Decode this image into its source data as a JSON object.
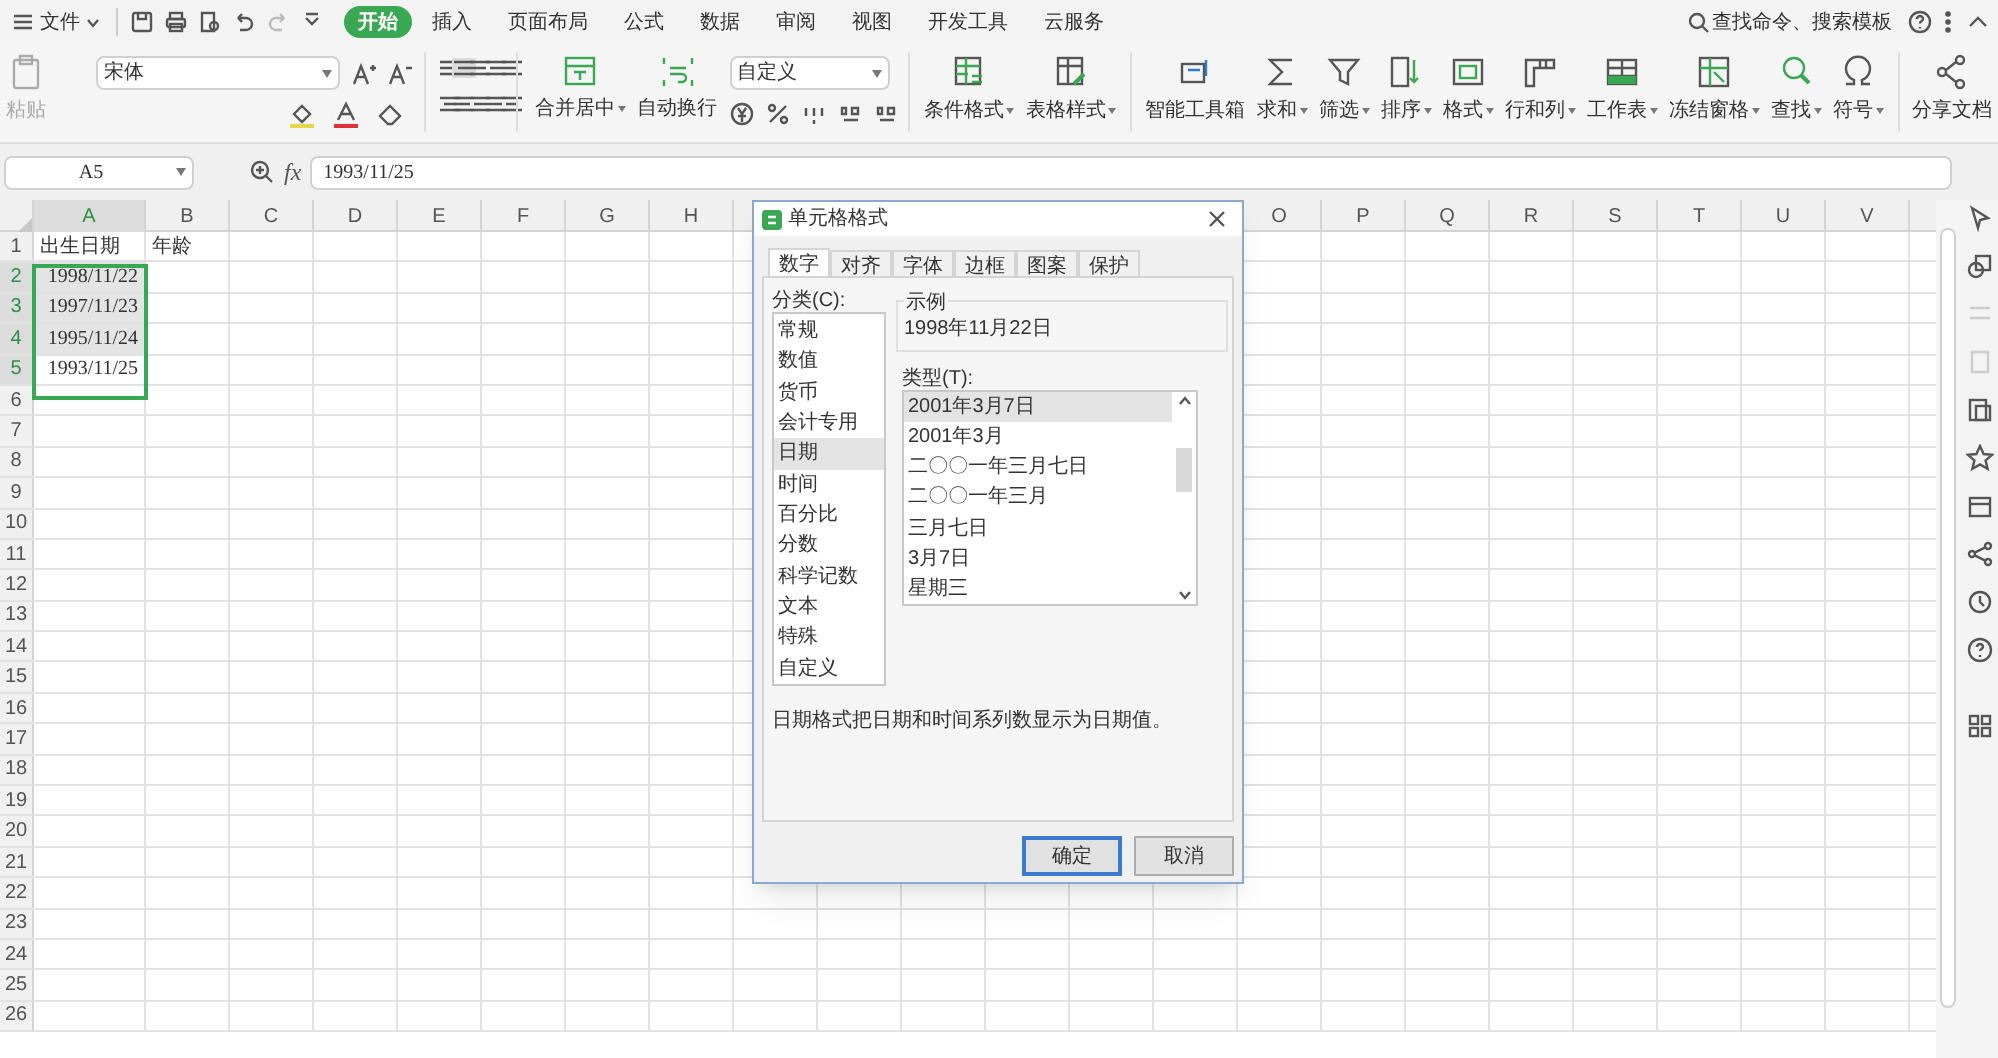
{
  "menu": {
    "file": "文件",
    "tabs": [
      {
        "label": "开始",
        "selected": true
      },
      {
        "label": "插入",
        "selected": false
      },
      {
        "label": "页面布局",
        "selected": false
      },
      {
        "label": "公式",
        "selected": false
      },
      {
        "label": "数据",
        "selected": false
      },
      {
        "label": "审阅",
        "selected": false
      },
      {
        "label": "视图",
        "selected": false
      },
      {
        "label": "开发工具",
        "selected": false
      },
      {
        "label": "云服务",
        "selected": false
      }
    ],
    "search": "查找命令、搜索模板"
  },
  "ribbon": {
    "paste": "粘贴",
    "font": "宋体",
    "number_format": "自定义",
    "buttons": [
      {
        "label": "合并居中",
        "dropdown": true
      },
      {
        "label": "自动换行",
        "dropdown": false
      }
    ],
    "buttons2": [
      {
        "label": "条件格式",
        "dropdown": true
      },
      {
        "label": "表格样式",
        "dropdown": true
      },
      {
        "label": "智能工具箱",
        "dropdown": false
      },
      {
        "label": "求和",
        "dropdown": true
      },
      {
        "label": "筛选",
        "dropdown": true
      },
      {
        "label": "排序",
        "dropdown": true
      },
      {
        "label": "格式",
        "dropdown": true
      },
      {
        "label": "行和列",
        "dropdown": true
      },
      {
        "label": "工作表",
        "dropdown": true
      },
      {
        "label": "冻结窗格",
        "dropdown": true
      },
      {
        "label": "查找",
        "dropdown": true
      },
      {
        "label": "符号",
        "dropdown": true
      },
      {
        "label": "分享文档",
        "dropdown": false
      }
    ]
  },
  "formula_bar": {
    "name_box": "A5",
    "fx": "fx",
    "value": "1993/11/25"
  },
  "sheet": {
    "columns": [
      {
        "label": "A",
        "selected": true
      },
      {
        "label": "B",
        "selected": false
      },
      {
        "label": "C",
        "selected": false
      },
      {
        "label": "D",
        "selected": false
      },
      {
        "label": "E",
        "selected": false
      },
      {
        "label": "F",
        "selected": false
      },
      {
        "label": "G",
        "selected": false
      },
      {
        "label": "H",
        "selected": false
      },
      {},
      {},
      {},
      {},
      {},
      {},
      {
        "label": "O",
        "selected": false
      },
      {
        "label": "P",
        "selected": false
      },
      {
        "label": "Q",
        "selected": false
      },
      {
        "label": "R",
        "selected": false
      },
      {
        "label": "S",
        "selected": false
      },
      {
        "label": "T",
        "selected": false
      },
      {
        "label": "U",
        "selected": false
      },
      {
        "label": "V",
        "selected": false
      }
    ],
    "rows": [
      {
        "label": "1",
        "selected": false,
        "cells": [
          {
            "text": "出生日期",
            "kind": "text",
            "selected": false
          },
          {
            "text": "年龄",
            "kind": "text",
            "selected": false
          }
        ]
      },
      {
        "label": "2",
        "selected": true,
        "cells": [
          {
            "text": "1998/11/22",
            "kind": "date",
            "selected": true,
            "active": false
          }
        ]
      },
      {
        "label": "3",
        "selected": true,
        "cells": [
          {
            "text": "1997/11/23",
            "kind": "date",
            "selected": true,
            "active": false
          }
        ]
      },
      {
        "label": "4",
        "selected": true,
        "cells": [
          {
            "text": "1995/11/24",
            "kind": "date",
            "selected": true,
            "active": false
          }
        ]
      },
      {
        "label": "5",
        "selected": true,
        "cells": [
          {
            "text": "1993/11/25",
            "kind": "date",
            "selected": true,
            "active": true
          }
        ]
      },
      {
        "label": "6",
        "selected": false
      },
      {
        "label": "7",
        "selected": false
      },
      {
        "label": "8",
        "selected": false
      },
      {
        "label": "9",
        "selected": false
      },
      {
        "label": "10",
        "selected": false
      },
      {
        "label": "11",
        "selected": false
      },
      {
        "label": "12",
        "selected": false
      },
      {
        "label": "13",
        "selected": false
      },
      {
        "label": "14",
        "selected": false
      },
      {
        "label": "15",
        "selected": false
      },
      {
        "label": "16",
        "selected": false
      },
      {
        "label": "17",
        "selected": false
      },
      {
        "label": "18",
        "selected": false
      },
      {
        "label": "19",
        "selected": false
      },
      {
        "label": "20",
        "selected": false
      },
      {
        "label": "21",
        "selected": false
      },
      {
        "label": "22",
        "selected": false
      },
      {
        "label": "23",
        "selected": false
      },
      {
        "label": "24",
        "selected": false
      },
      {
        "label": "25",
        "selected": false
      },
      {
        "label": "26",
        "selected": false
      }
    ]
  },
  "dialog": {
    "title": "单元格格式",
    "tabs": [
      {
        "label": "数字",
        "selected": true
      },
      {
        "label": "对齐",
        "selected": false
      },
      {
        "label": "字体",
        "selected": false
      },
      {
        "label": "边框",
        "selected": false
      },
      {
        "label": "图案",
        "selected": false
      },
      {
        "label": "保护",
        "selected": false
      }
    ],
    "category_label": "分类(C):",
    "categories": [
      {
        "label": "常规",
        "selected": false
      },
      {
        "label": "数值",
        "selected": false
      },
      {
        "label": "货币",
        "selected": false
      },
      {
        "label": "会计专用",
        "selected": false
      },
      {
        "label": "日期",
        "selected": true
      },
      {
        "label": "时间",
        "selected": false
      },
      {
        "label": "百分比",
        "selected": false
      },
      {
        "label": "分数",
        "selected": false
      },
      {
        "label": "科学记数",
        "selected": false
      },
      {
        "label": "文本",
        "selected": false
      },
      {
        "label": "特殊",
        "selected": false
      },
      {
        "label": "自定义",
        "selected": false
      }
    ],
    "sample_label": "示例",
    "sample": "1998年11月22日",
    "type_label": "类型(T):",
    "types": [
      {
        "label": "2001年3月7日",
        "selected": true
      },
      {
        "label": "2001年3月",
        "selected": false
      },
      {
        "label": "二〇〇一年三月七日",
        "selected": false
      },
      {
        "label": "二〇〇一年三月",
        "selected": false
      },
      {
        "label": "三月七日",
        "selected": false
      },
      {
        "label": "3月7日",
        "selected": false
      },
      {
        "label": "星期三",
        "selected": false
      }
    ],
    "description": "日期格式把日期和时间系列数显示为日期值。",
    "buttons": [
      {
        "label": "确定",
        "default": true
      },
      {
        "label": "取消",
        "default": false
      }
    ]
  }
}
